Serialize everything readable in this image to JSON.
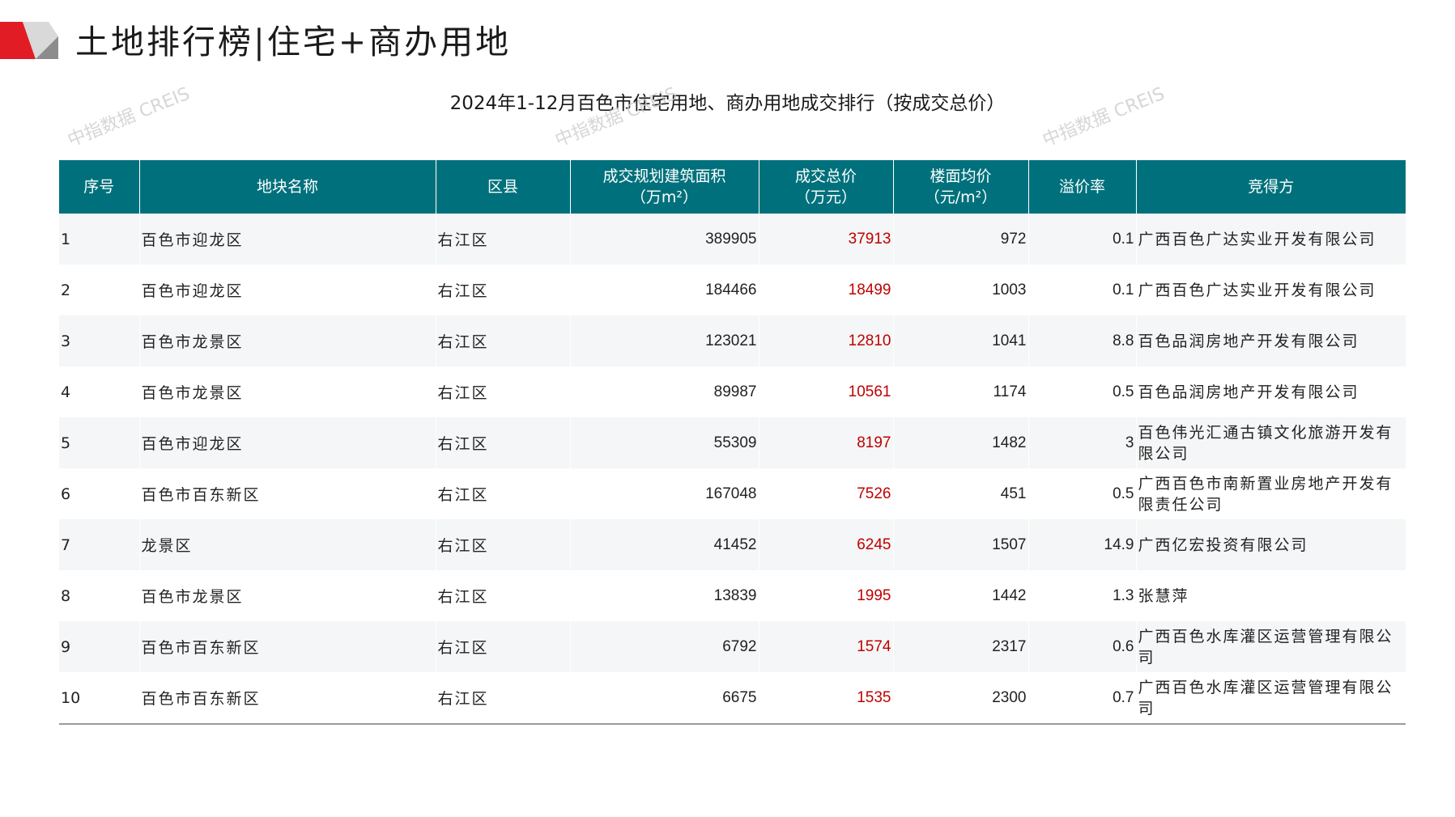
{
  "page_title": "土地排行榜|住宅+商办用地",
  "table_title": "2024年1-12月百色市住宅用地、商办用地成交排行（按成交总价）",
  "watermark_text": "中指数据 CREIS",
  "colors": {
    "header_bg": "#00717c",
    "logo_red": "#e21c24",
    "logo_gray": "#8c8c8c",
    "price_red": "#c00000",
    "row_stripe": "#f4f6f7"
  },
  "table": {
    "headers": {
      "rank": "序号",
      "parcel": "地块名称",
      "district": "区县",
      "area_line1": "成交规划建筑面积",
      "area_line2": "（万m²）",
      "total_line1": "成交总价",
      "total_line2": "（万元）",
      "unit_line1": "楼面均价",
      "unit_line2": "（元/m²）",
      "premium": "溢价率",
      "winner": "竞得方"
    },
    "rows": [
      {
        "rank": "1",
        "parcel": "百色市迎龙区",
        "district": "右江区",
        "area": "389905",
        "total": "37913",
        "unit_price": "972",
        "premium": "0.1",
        "winner": "广西百色广达实业开发有限公司"
      },
      {
        "rank": "2",
        "parcel": "百色市迎龙区",
        "district": "右江区",
        "area": "184466",
        "total": "18499",
        "unit_price": "1003",
        "premium": "0.1",
        "winner": "广西百色广达实业开发有限公司"
      },
      {
        "rank": "3",
        "parcel": "百色市龙景区",
        "district": "右江区",
        "area": "123021",
        "total": "12810",
        "unit_price": "1041",
        "premium": "8.8",
        "winner": "百色品润房地产开发有限公司"
      },
      {
        "rank": "4",
        "parcel": "百色市龙景区",
        "district": "右江区",
        "area": "89987",
        "total": "10561",
        "unit_price": "1174",
        "premium": "0.5",
        "winner": "百色品润房地产开发有限公司"
      },
      {
        "rank": "5",
        "parcel": "百色市迎龙区",
        "district": "右江区",
        "area": "55309",
        "total": "8197",
        "unit_price": "1482",
        "premium": "3",
        "winner": "百色伟光汇通古镇文化旅游开发有限公司"
      },
      {
        "rank": "6",
        "parcel": "百色市百东新区",
        "district": "右江区",
        "area": "167048",
        "total": "7526",
        "unit_price": "451",
        "premium": "0.5",
        "winner": "广西百色市南新置业房地产开发有限责任公司"
      },
      {
        "rank": "7",
        "parcel": "龙景区",
        "district": "右江区",
        "area": "41452",
        "total": "6245",
        "unit_price": "1507",
        "premium": "14.9",
        "winner": "广西亿宏投资有限公司"
      },
      {
        "rank": "8",
        "parcel": "百色市龙景区",
        "district": "右江区",
        "area": "13839",
        "total": "1995",
        "unit_price": "1442",
        "premium": "1.3",
        "winner": "张慧萍"
      },
      {
        "rank": "9",
        "parcel": "百色市百东新区",
        "district": "右江区",
        "area": "6792",
        "total": "1574",
        "unit_price": "2317",
        "premium": "0.6",
        "winner": "广西百色水库灌区运营管理有限公司"
      },
      {
        "rank": "10",
        "parcel": "百色市百东新区",
        "district": "右江区",
        "area": "6675",
        "total": "1535",
        "unit_price": "2300",
        "premium": "0.7",
        "winner": "广西百色水库灌区运营管理有限公司"
      }
    ]
  }
}
